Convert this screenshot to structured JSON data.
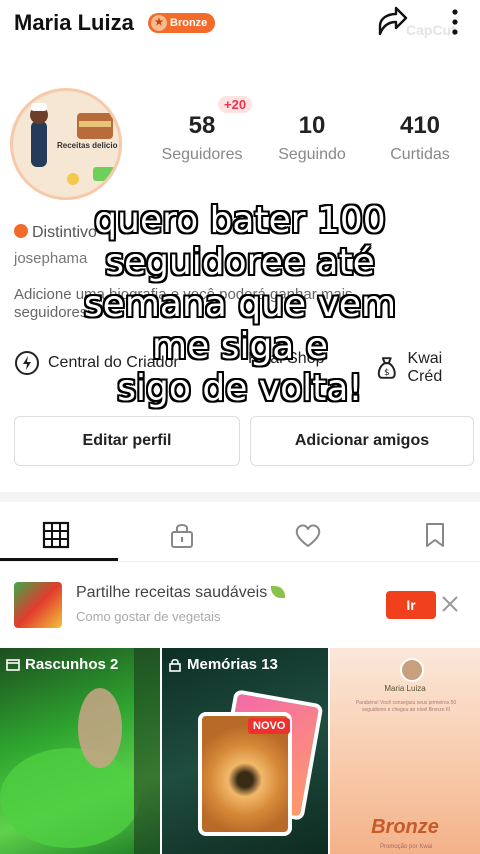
{
  "header": {
    "name": "Maria Luiza",
    "badge": "Bronze",
    "watermark": "CapCut"
  },
  "profile": {
    "avatar_text": "Receitas delicio",
    "new_followers": "+20",
    "stats": [
      {
        "value": "58",
        "label": "Seguidores"
      },
      {
        "value": "10",
        "label": "Seguindo"
      },
      {
        "value": "410",
        "label": "Curtidas"
      }
    ],
    "distintivo": "Distintivo",
    "username": "josephama",
    "bio": "Adicione uma biografia e você poderá ganhar mais seguidores"
  },
  "tools": [
    {
      "label": "Central do Criador",
      "icon": "lightning-icon"
    },
    {
      "label": "Kwai Shop",
      "icon": "shop-icon"
    },
    {
      "label": "Kwai Créd",
      "icon": "money-bag-icon"
    }
  ],
  "buttons": {
    "edit": "Editar perfil",
    "add_friends": "Adicionar amigos"
  },
  "tabs": [
    "grid-icon",
    "lock-icon",
    "heart-icon",
    "bookmark-icon"
  ],
  "promo": {
    "title": "Partilhe receitas saudáveis",
    "subtitle": "Como gostar de vegetais",
    "button": "Ir"
  },
  "tiles": {
    "drafts": "Rascunhos 2",
    "memories": "Memórias 13",
    "novo": "NOVO",
    "t3_name": "Maria Luiza",
    "t3_text": "Parabéns! Você conseguiu seus primeiros 50 seguidores e chegou ao nível Bronze III",
    "t3_bronze": "Bronze",
    "t3_foot": "Promoção por Kwai"
  },
  "overlay": {
    "lines": [
      "quero bater 100",
      "seguidoree até",
      "semana que vem",
      "me siga e",
      "sigo de volta!"
    ]
  },
  "colors": {
    "accent": "#f36b2b",
    "ir_button": "#f0401c",
    "new_badge": "#f0314a"
  }
}
